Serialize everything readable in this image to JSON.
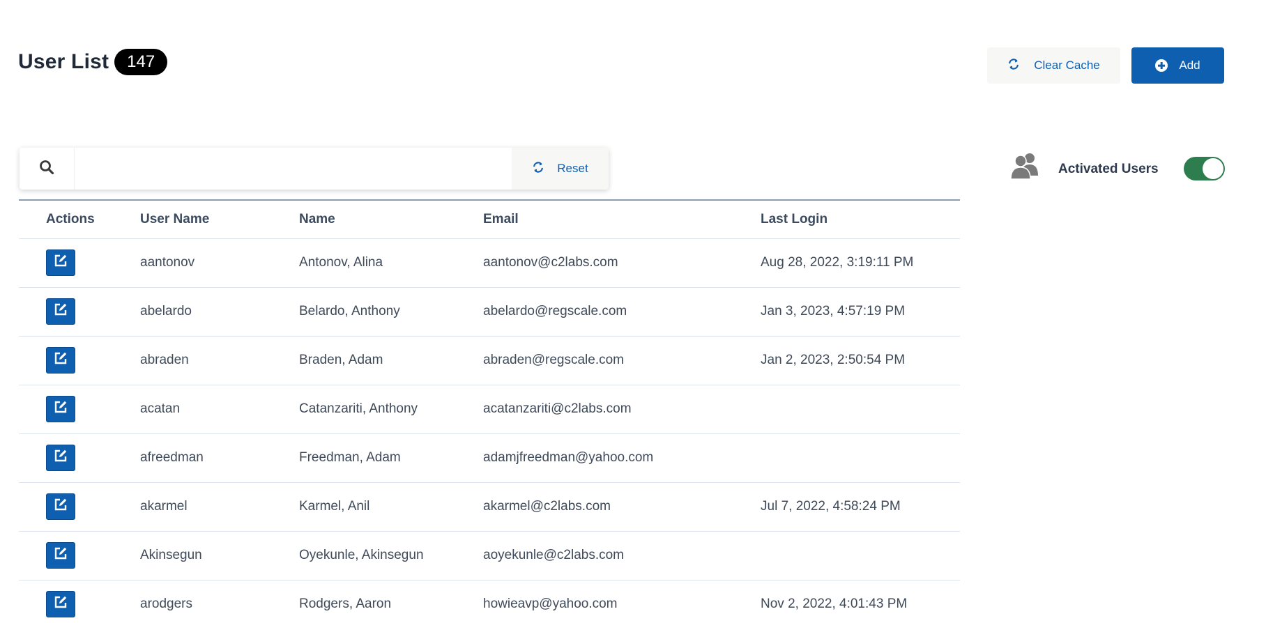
{
  "header": {
    "title": "User List",
    "count": "147",
    "clear_cache_label": "Clear Cache",
    "add_label": "Add"
  },
  "search": {
    "value": "",
    "placeholder": "",
    "reset_label": "Reset"
  },
  "filter": {
    "activated_label": "Activated Users",
    "activated_on": true
  },
  "table": {
    "columns": [
      "Actions",
      "User Name",
      "Name",
      "Email",
      "Last Login"
    ],
    "rows": [
      {
        "username": "aantonov",
        "name": "Antonov, Alina",
        "email": "aantonov@c2labs.com",
        "last_login": "Aug 28, 2022, 3:19:11 PM"
      },
      {
        "username": "abelardo",
        "name": "Belardo, Anthony",
        "email": "abelardo@regscale.com",
        "last_login": "Jan 3, 2023, 4:57:19 PM"
      },
      {
        "username": "abraden",
        "name": "Braden, Adam",
        "email": "abraden@regscale.com",
        "last_login": "Jan 2, 2023, 2:50:54 PM"
      },
      {
        "username": "acatan",
        "name": "Catanzariti, Anthony",
        "email": "acatanzariti@c2labs.com",
        "last_login": ""
      },
      {
        "username": "afreedman",
        "name": "Freedman, Adam",
        "email": "adamjfreedman@yahoo.com",
        "last_login": ""
      },
      {
        "username": "akarmel",
        "name": "Karmel, Anil",
        "email": "akarmel@c2labs.com",
        "last_login": "Jul 7, 2022, 4:58:24 PM"
      },
      {
        "username": "Akinsegun",
        "name": "Oyekunle, Akinsegun",
        "email": "aoyekunle@c2labs.com",
        "last_login": ""
      },
      {
        "username": "arodgers",
        "name": "Rodgers, Aaron",
        "email": "howieavp@yahoo.com",
        "last_login": "Nov 2, 2022, 4:01:43 PM"
      }
    ]
  },
  "colors": {
    "primary": "#0f5fb0",
    "toggle_on": "#2e7d4f",
    "badge_bg": "#000000"
  },
  "icons": {
    "clear_cache": "refresh-icon",
    "add": "plus-circle-icon",
    "search": "search-icon",
    "reset": "refresh-icon",
    "activated": "users-icon",
    "row_action": "edit-icon"
  }
}
